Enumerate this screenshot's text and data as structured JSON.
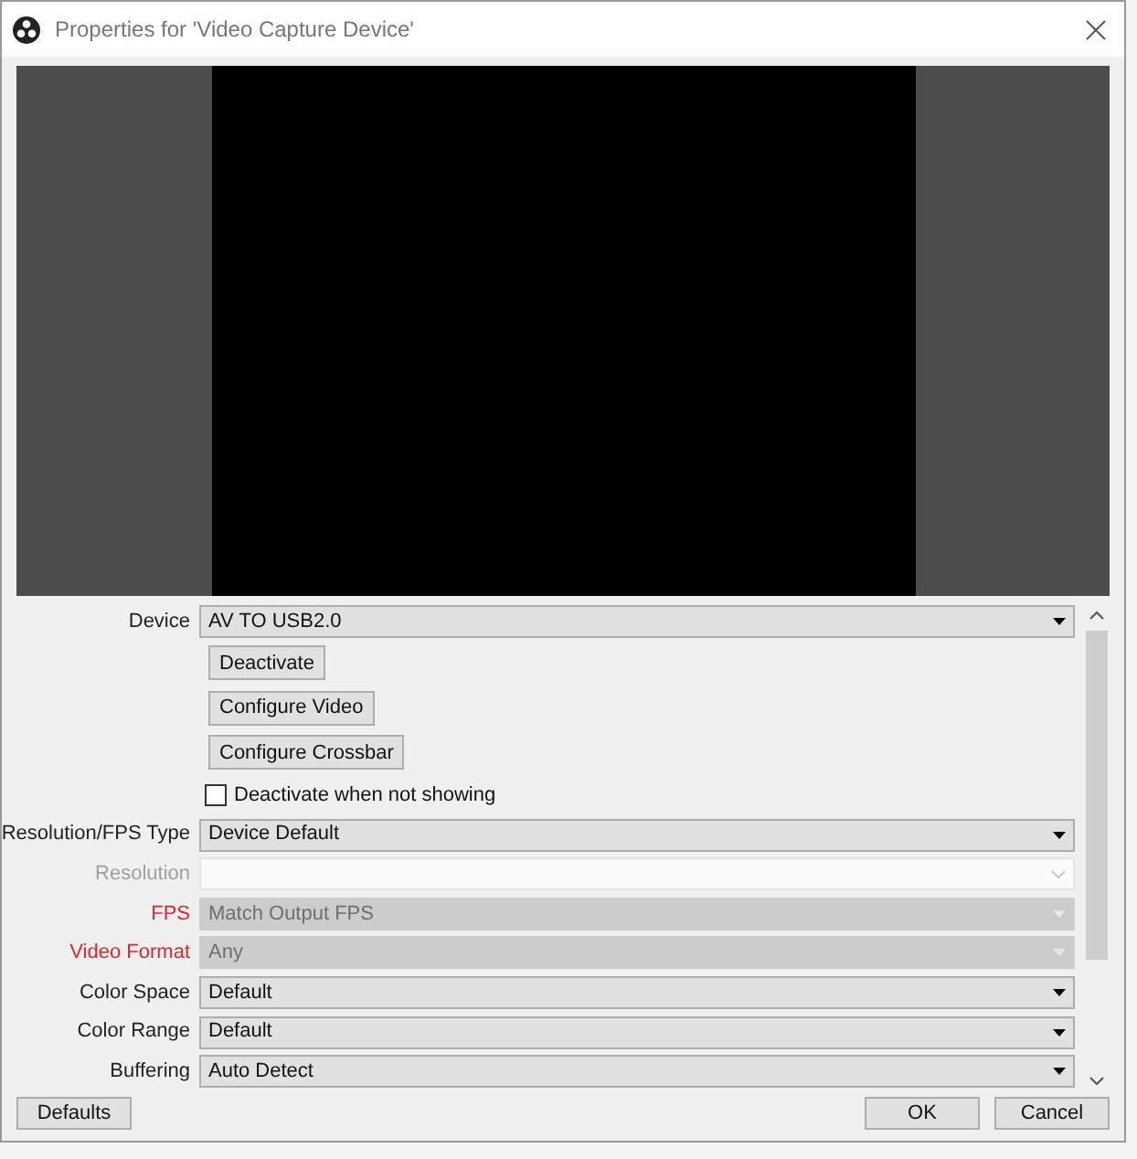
{
  "window": {
    "title": "Properties for 'Video Capture Device'"
  },
  "properties": [
    {
      "kind": "dropdown",
      "label": "Device",
      "value": "AV TO USB2.0",
      "disabled": false,
      "warning": false
    },
    {
      "kind": "button",
      "text": "Deactivate"
    },
    {
      "kind": "button",
      "text": "Configure Video"
    },
    {
      "kind": "button",
      "text": "Configure Crossbar"
    },
    {
      "kind": "checkbox",
      "text": "Deactivate when not showing",
      "checked": false
    },
    {
      "kind": "dropdown",
      "label": "Resolution/FPS Type",
      "value": "Device Default",
      "disabled": false,
      "warning": false
    },
    {
      "kind": "editable",
      "label": "Resolution",
      "disabled": true,
      "warning": false
    },
    {
      "kind": "dropdown",
      "label": "FPS",
      "value": "Match Output FPS",
      "disabled": true,
      "warning": true
    },
    {
      "kind": "dropdown",
      "label": "Video Format",
      "value": "Any",
      "disabled": true,
      "warning": true
    },
    {
      "kind": "dropdown",
      "label": "Color Space",
      "value": "Default",
      "disabled": false,
      "warning": false
    },
    {
      "kind": "dropdown",
      "label": "Color Range",
      "value": "Default",
      "disabled": false,
      "warning": false
    },
    {
      "kind": "dropdown",
      "label": "Buffering",
      "value": "Auto Detect",
      "disabled": false,
      "warning": false
    }
  ],
  "buttons": {
    "left": [
      "Defaults"
    ],
    "right": [
      "OK",
      "Cancel"
    ]
  }
}
